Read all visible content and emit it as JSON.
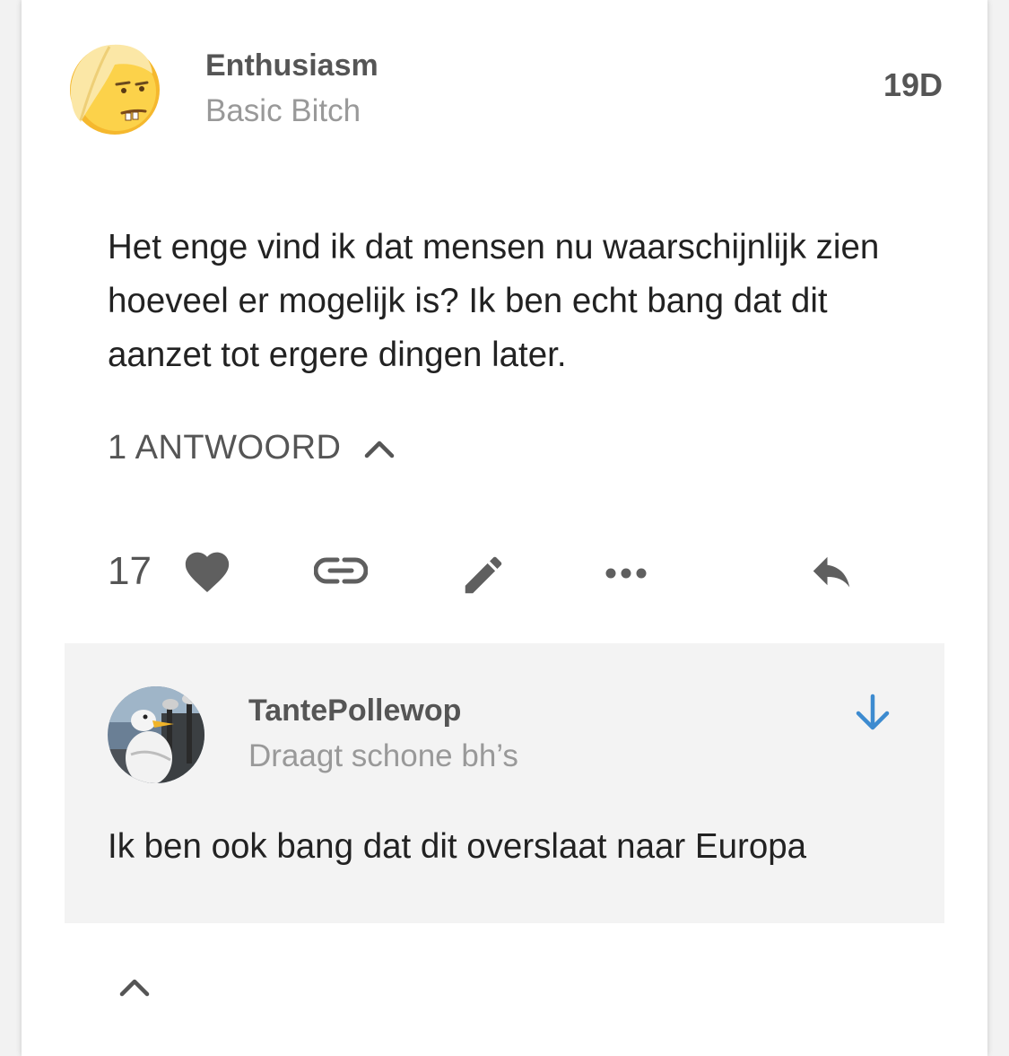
{
  "post": {
    "username": "Enthusiasm",
    "user_title": "Basic Bitch",
    "age": "19D",
    "body": "Het enge vind ik dat mensen nu waarschijnlijk zien hoeveel er mogelijk is? Ik ben echt bang dat dit aanzet tot ergere dingen later.",
    "replies_label": "1 ANTWOORD",
    "like_count": "17"
  },
  "reply": {
    "username": "TantePollewop",
    "user_title": "Draagt schone bh’s",
    "body": "Ik ben ook bang dat dit overslaat naar Europa"
  },
  "icons": {
    "like": "heart-icon",
    "link": "link-icon",
    "edit": "pencil-icon",
    "more": "more-dots-icon",
    "reply": "reply-arrow-icon",
    "jump": "arrow-down-icon",
    "collapse": "chevron-up-icon"
  },
  "colors": {
    "accent_blue": "#3d8bd0",
    "icon_gray": "#5f5f5f",
    "reply_bg": "#f3f3f3"
  }
}
